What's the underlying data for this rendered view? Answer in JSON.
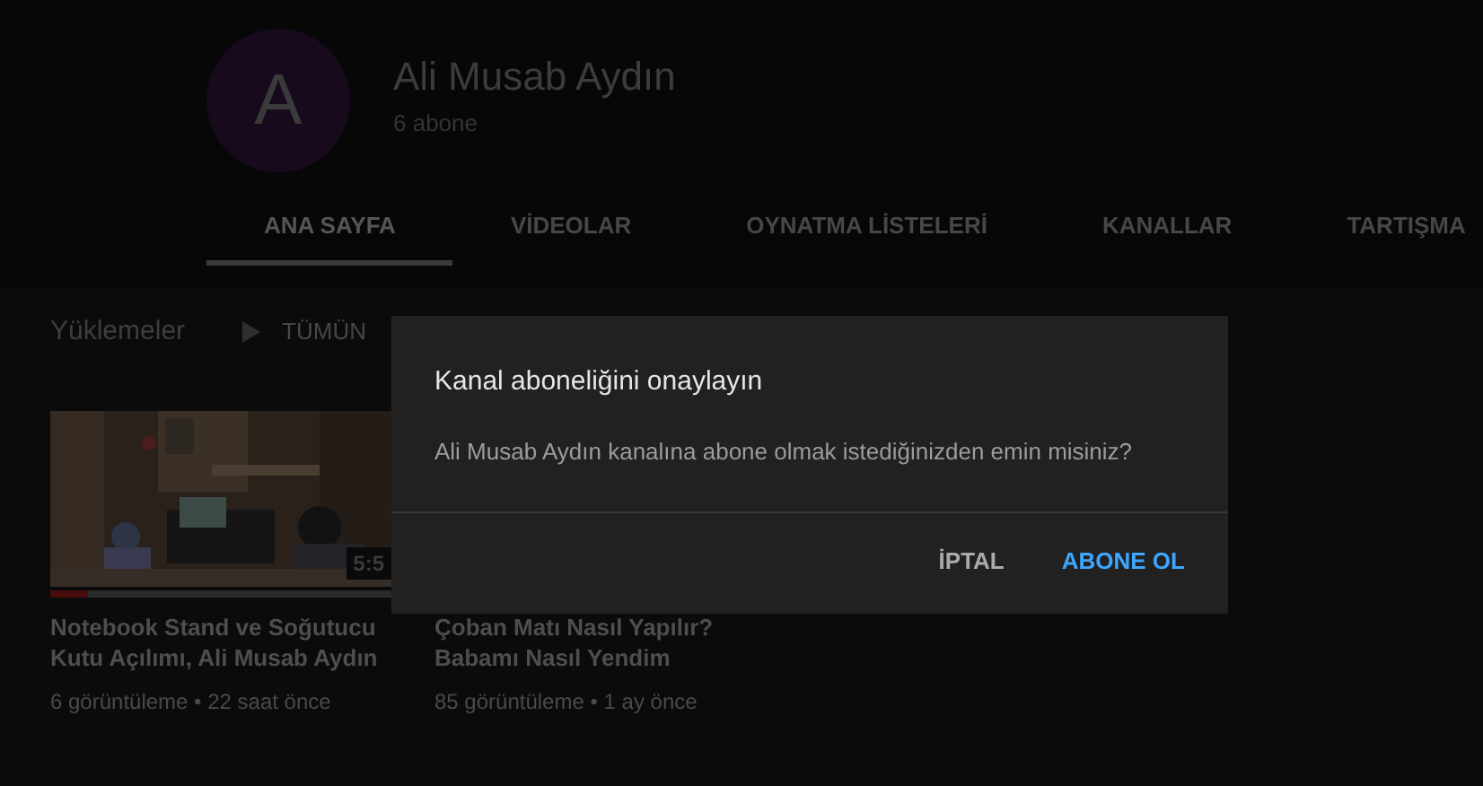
{
  "channel": {
    "avatar_letter": "A",
    "name": "Ali Musab Aydın",
    "subscribers": "6 abone"
  },
  "tabs": [
    {
      "label": "ANA SAYFA",
      "selected": true
    },
    {
      "label": "VİDEOLAR",
      "selected": false
    },
    {
      "label": "OYNATMA LİSTELERİ",
      "selected": false
    },
    {
      "label": "KANALLAR",
      "selected": false
    },
    {
      "label": "TARTIŞMA",
      "selected": false
    }
  ],
  "section": {
    "title": "Yüklemeler",
    "play_all": "TÜMÜN"
  },
  "videos": [
    {
      "kind": "visible",
      "duration": "5:5",
      "watched": {
        "level": 0.11
      },
      "title": "Notebook Stand ve Soğutucu Kutu Açılımı, Ali Musab Aydın",
      "meta": "6 görüntüleme • 22 saat önce"
    },
    {
      "kind": "hidden",
      "title": "Çoban Matı Nasıl Yapılır? Babamı Nasıl Yendim",
      "meta": "85 görüntüleme • 1 ay önce"
    }
  ],
  "dialog": {
    "title": "Kanal aboneliğini onaylayın",
    "message": "Ali Musab Aydın kanalına abone olmak istediğinizden emin misiniz?",
    "buttons": [
      {
        "label": "İPTAL",
        "kind": "cancel"
      },
      {
        "label": "ABONE OL",
        "kind": "confirm"
      }
    ]
  }
}
